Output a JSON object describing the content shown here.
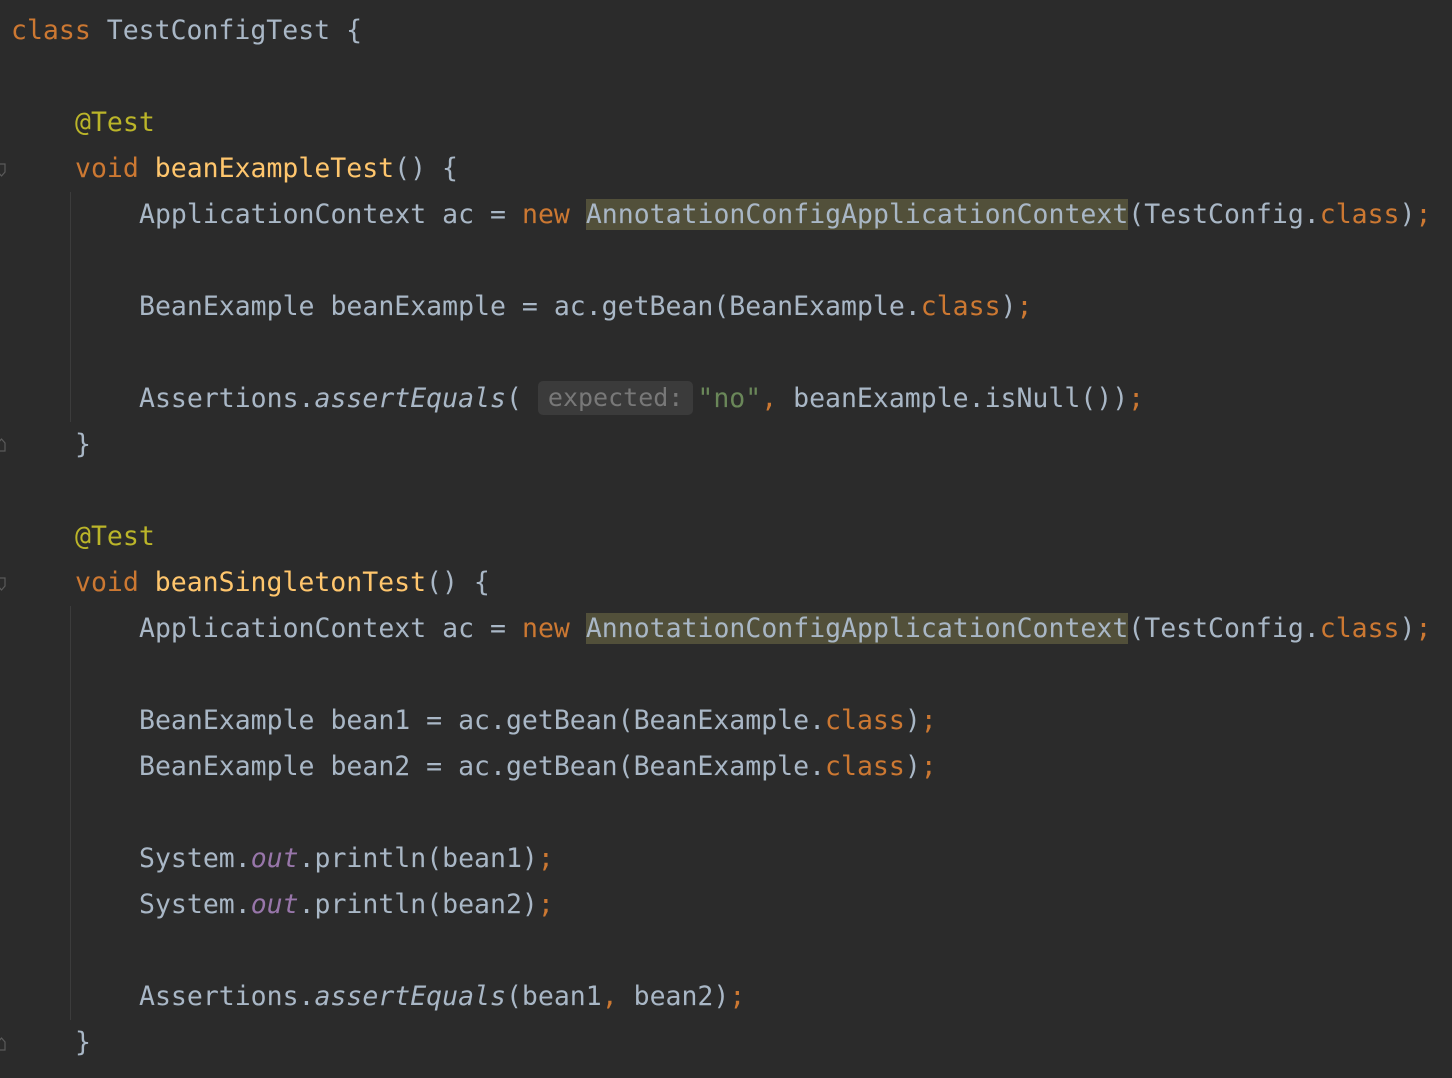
{
  "keywords": {
    "class": "class",
    "void": "void",
    "new": "new",
    "class_literal": "class"
  },
  "class_decl": {
    "name": "TestConfigTest",
    "open_brace": "{"
  },
  "method1": {
    "annotation": "@Test",
    "name": "beanExampleTest",
    "signature_tail": "() {",
    "line1": {
      "type": "ApplicationContext",
      "var": "ac",
      "eq": "=",
      "ctor": "AnnotationConfigApplicationContext",
      "args_start": "(TestConfig.",
      "args_end": ")"
    },
    "line2": {
      "text": "BeanExample beanExample = ac.getBean(BeanExample.",
      "close": ")"
    },
    "line3": {
      "receiver": "Assertions.",
      "method": "assertEquals",
      "open": "(",
      "hint": "expected:",
      "string": "\"no\"",
      "comma": ",",
      "rest": " beanExample.isNull())"
    },
    "close_brace": "}"
  },
  "method2": {
    "annotation": "@Test",
    "name": "beanSingletonTest",
    "signature_tail": "() {",
    "line1": {
      "type": "ApplicationContext",
      "var": "ac",
      "eq": "=",
      "ctor": "AnnotationConfigApplicationContext",
      "args_start": "(TestConfig.",
      "args_end": ")"
    },
    "line2": {
      "text": "BeanExample bean1 = ac.getBean(BeanExample.",
      "close": ")"
    },
    "line3": {
      "text": "BeanExample bean2 = ac.getBean(BeanExample.",
      "close": ")"
    },
    "line4": {
      "receiver": "System.",
      "field": "out",
      "call": ".println(bean1)"
    },
    "line5": {
      "receiver": "System.",
      "field": "out",
      "call": ".println(bean2)"
    },
    "line6": {
      "receiver": "Assertions.",
      "method": "assertEquals",
      "open": "(bean1",
      "comma": ",",
      "rest": " bean2)"
    },
    "close_brace": "}"
  },
  "semicolon": ";",
  "colors": {
    "background": "#2b2b2b",
    "default_text": "#a9b7c6",
    "keyword": "#cc7832",
    "annotation": "#bbb529",
    "method_declaration": "#ffc66d",
    "string": "#6a8759",
    "static_field": "#9876aa",
    "usage_highlight": "#52503a",
    "inlay_hint": "#787878"
  }
}
